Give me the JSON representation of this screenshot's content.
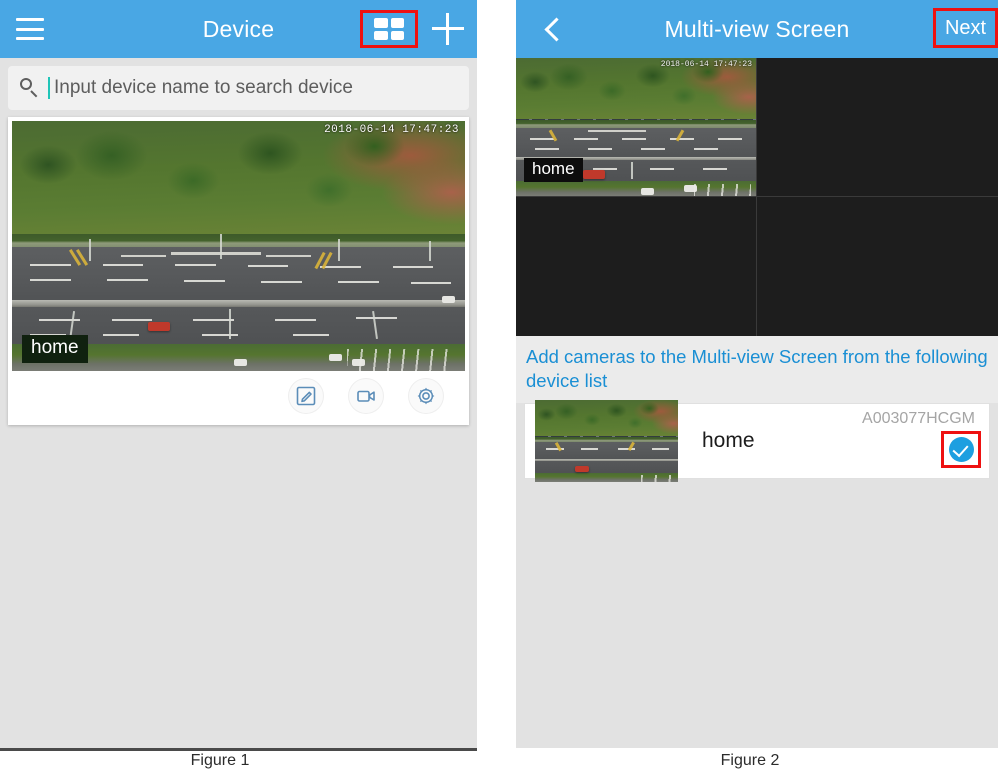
{
  "figure1": {
    "caption": "Figure 1",
    "header": {
      "title": "Device",
      "menu_icon": "hamburger-menu-icon",
      "grid_icon": "multi-view-grid-icon",
      "add_icon": "plus-add-icon",
      "highlight_color": "#ee1111",
      "bar_color": "#49a7e4"
    },
    "search": {
      "placeholder": "Input device name to search device",
      "value": "",
      "icon": "search-magnifier-icon",
      "caret_color": "#20c5b8"
    },
    "device_card": {
      "timestamp": "2018-06-14  17:47:23",
      "name": "home",
      "tools": [
        {
          "icon": "edit-pencil-icon",
          "label": "Edit"
        },
        {
          "icon": "video-camera-icon",
          "label": "Playback"
        },
        {
          "icon": "gear-settings-icon",
          "label": "Settings"
        }
      ]
    }
  },
  "figure2": {
    "caption": "Figure 2",
    "header": {
      "title": "Multi-view Screen",
      "back_icon": "back-chevron-icon",
      "next_label": "Next",
      "highlight_color": "#ee1111",
      "bar_color": "#49a7e4"
    },
    "multiview": {
      "cells": [
        {
          "filled": true,
          "name": "home",
          "timestamp": "2018-06-14 17:47:23"
        },
        {
          "filled": false,
          "name": "",
          "timestamp": ""
        },
        {
          "filled": false,
          "name": "",
          "timestamp": ""
        },
        {
          "filled": false,
          "name": "",
          "timestamp": ""
        }
      ]
    },
    "hint": "Add cameras to the Multi-view Screen from the following device list",
    "device_list": [
      {
        "name": "home",
        "id": "A003077HCGM",
        "selected": true,
        "check_icon": "check-circle-icon",
        "check_color": "#1d9fe0"
      }
    ]
  }
}
